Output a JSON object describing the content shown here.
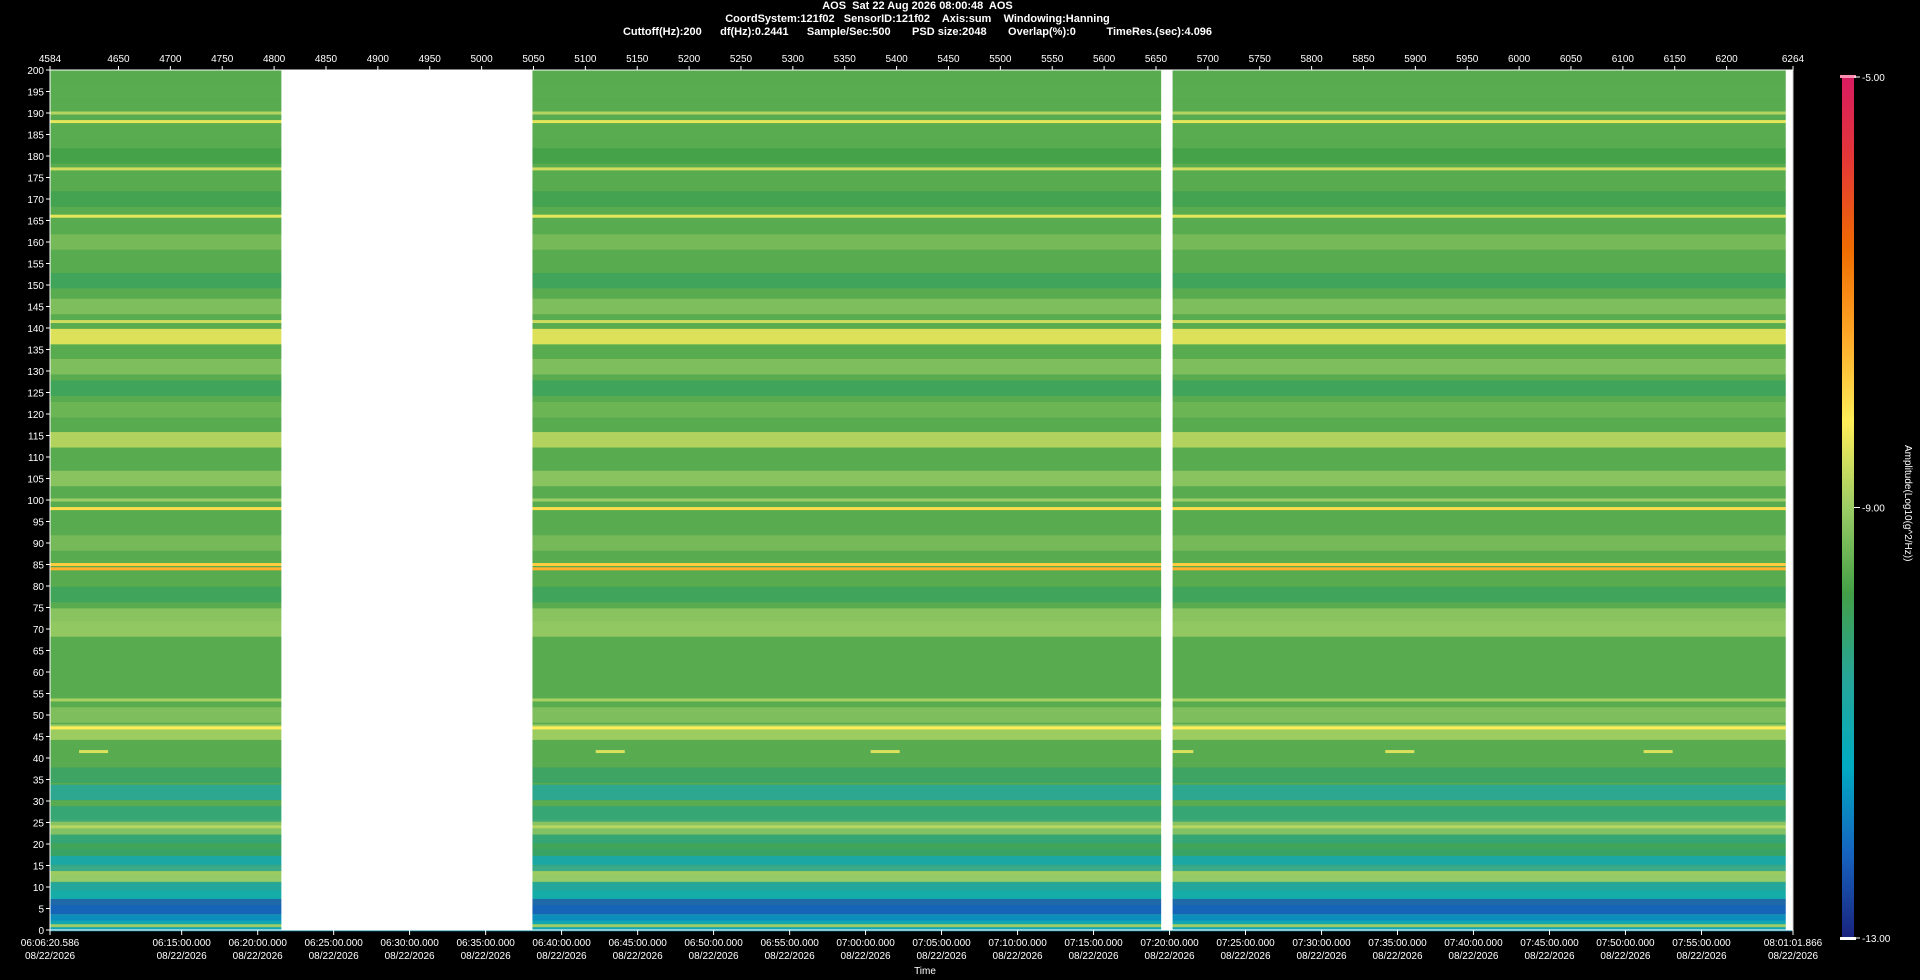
{
  "header": {
    "line1": "AOS  Sat 22 Aug 2026 08:00:48  AOS",
    "line2": "CoordSystem:121f02   SensorID:121f02    Axis:sum    Windowing:Hanning",
    "line3": "Cuttoff(Hz):200      df(Hz):0.2441      Sample/Sec:500       PSD size:2048       Overlap(%):0          TimeRes.(sec):4.096"
  },
  "chart_data": {
    "type": "heatmap",
    "title": "AOS  Sat 22 Aug 2026 08:00:48  AOS",
    "xlabel": "Time",
    "ylabel": "",
    "colorbar_label": "Amplitude(Log10(g^2/Hz))",
    "colorbar_range": [
      -13.0,
      -5.0
    ],
    "colorbar_ticks": [
      "-5.00",
      "-9.00",
      "-13.00"
    ],
    "colormap": [
      "#1a237e",
      "#1565c0",
      "#00acc1",
      "#26a69a",
      "#43a047",
      "#9ccc65",
      "#ffee58",
      "#ffa726",
      "#ef6c00",
      "#e53935",
      "#d81b60"
    ],
    "ylim": [
      0,
      200
    ],
    "y_ticks": [
      0,
      5,
      10,
      15,
      20,
      25,
      30,
      35,
      40,
      45,
      50,
      55,
      60,
      65,
      70,
      75,
      80,
      85,
      90,
      95,
      100,
      105,
      110,
      115,
      120,
      125,
      130,
      135,
      140,
      145,
      150,
      155,
      160,
      165,
      170,
      175,
      180,
      185,
      190,
      195,
      200
    ],
    "top_axis_range": [
      4584,
      6264
    ],
    "top_ticks": [
      4584,
      4650,
      4700,
      4750,
      4800,
      4850,
      4900,
      4950,
      5000,
      5050,
      5100,
      5150,
      5200,
      5250,
      5300,
      5350,
      5400,
      5450,
      5500,
      5550,
      5600,
      5650,
      5700,
      5750,
      5800,
      5850,
      5900,
      5950,
      6000,
      6050,
      6100,
      6150,
      6200,
      6264
    ],
    "time_ticks": [
      {
        "time": "06:06:20.586",
        "date": "08/22/2026",
        "top_value": 4584
      },
      {
        "time": "06:15:00.000",
        "date": "08/22/2026",
        "top_value": 4710.9
      },
      {
        "time": "06:20:00.000",
        "date": "08/22/2026",
        "top_value": 4784.2
      },
      {
        "time": "06:25:00.000",
        "date": "08/22/2026",
        "top_value": 4857.4
      },
      {
        "time": "06:30:00.000",
        "date": "08/22/2026",
        "top_value": 4930.6
      },
      {
        "time": "06:35:00.000",
        "date": "08/22/2026",
        "top_value": 5003.9
      },
      {
        "time": "06:40:00.000",
        "date": "08/22/2026",
        "top_value": 5077.1
      },
      {
        "time": "06:45:00.000",
        "date": "08/22/2026",
        "top_value": 5150.4
      },
      {
        "time": "06:50:00.000",
        "date": "08/22/2026",
        "top_value": 5223.6
      },
      {
        "time": "06:55:00.000",
        "date": "08/22/2026",
        "top_value": 5296.9
      },
      {
        "time": "07:00:00.000",
        "date": "08/22/2026",
        "top_value": 5370.1
      },
      {
        "time": "07:05:00.000",
        "date": "08/22/2026",
        "top_value": 5443.3
      },
      {
        "time": "07:10:00.000",
        "date": "08/22/2026",
        "top_value": 5516.6
      },
      {
        "time": "07:15:00.000",
        "date": "08/22/2026",
        "top_value": 5589.8
      },
      {
        "time": "07:20:00.000",
        "date": "08/22/2026",
        "top_value": 5663.1
      },
      {
        "time": "07:25:00.000",
        "date": "08/22/2026",
        "top_value": 5736.3
      },
      {
        "time": "07:30:00.000",
        "date": "08/22/2026",
        "top_value": 5809.6
      },
      {
        "time": "07:35:00.000",
        "date": "08/22/2026",
        "top_value": 5882.8
      },
      {
        "time": "07:40:00.000",
        "date": "08/22/2026",
        "top_value": 5956.0
      },
      {
        "time": "07:45:00.000",
        "date": "08/22/2026",
        "top_value": 6029.3
      },
      {
        "time": "07:50:00.000",
        "date": "08/22/2026",
        "top_value": 6102.5
      },
      {
        "time": "07:55:00.000",
        "date": "08/22/2026",
        "top_value": 6175.8
      },
      {
        "time": "08:01:01.866",
        "date": "08/22/2026",
        "top_value": 6264
      }
    ],
    "data_gaps": [
      [
        4807,
        5049
      ],
      [
        5655,
        5666
      ],
      [
        6257,
        6264
      ]
    ],
    "background_level": -9.6,
    "bands": [
      {
        "freq": 1.5,
        "level": -11.5
      },
      {
        "freq": 4,
        "level": -11.8
      },
      {
        "freq": 5.5,
        "level": -12.3
      },
      {
        "freq": 9,
        "level": -11.2
      },
      {
        "freq": 11,
        "level": -10.6
      },
      {
        "freq": 13,
        "level": -8.9
      },
      {
        "freq": 15.5,
        "level": -10.5
      },
      {
        "freq": 17,
        "level": -10.9
      },
      {
        "freq": 19,
        "level": -10.0
      },
      {
        "freq": 22,
        "level": -10.3
      },
      {
        "freq": 24,
        "level": -9.1
      },
      {
        "freq": 27,
        "level": -10.3
      },
      {
        "freq": 32,
        "level": -10.6
      },
      {
        "freq": 36,
        "level": -10.1
      },
      {
        "freq": 46,
        "level": -8.9
      },
      {
        "freq": 50,
        "level": -9.2
      },
      {
        "freq": 70,
        "level": -9.0
      },
      {
        "freq": 73,
        "level": -9.1
      },
      {
        "freq": 78,
        "level": -10.0
      },
      {
        "freq": 90,
        "level": -9.3
      },
      {
        "freq": 105,
        "level": -9.1
      },
      {
        "freq": 114,
        "level": -8.7
      },
      {
        "freq": 121,
        "level": -9.4
      },
      {
        "freq": 126,
        "level": -10.0
      },
      {
        "freq": 131,
        "level": -9.2
      },
      {
        "freq": 138,
        "level": -8.3
      },
      {
        "freq": 145,
        "level": -9.2
      },
      {
        "freq": 151,
        "level": -10.0
      },
      {
        "freq": 160,
        "level": -9.3
      },
      {
        "freq": 170,
        "level": -9.9
      },
      {
        "freq": 180,
        "level": -9.8
      },
      {
        "freq": 186,
        "level": -9.6
      },
      {
        "freq": 195,
        "level": -9.6
      }
    ],
    "tones": [
      {
        "freq": 1,
        "level": -9.0
      },
      {
        "freq": 24,
        "level": -8.8
      },
      {
        "freq": 47,
        "level": -8.2
      },
      {
        "freq": 53.5,
        "level": -8.9
      },
      {
        "freq": 84,
        "level": -7.5
      },
      {
        "freq": 85,
        "level": -7.8
      },
      {
        "freq": 98,
        "level": -8.0
      },
      {
        "freq": 100,
        "level": -9.0
      },
      {
        "freq": 141.5,
        "level": -8.6
      },
      {
        "freq": 166,
        "level": -8.4
      },
      {
        "freq": 177,
        "level": -8.6
      },
      {
        "freq": 188,
        "level": -8.4
      },
      {
        "freq": 190,
        "level": -8.8
      }
    ],
    "events": [
      {
        "start": 4612,
        "end": 4640,
        "freq": 41.5,
        "level": -8.5
      },
      {
        "start": 5110,
        "end": 5138,
        "freq": 41.5,
        "level": -8.5
      },
      {
        "start": 5375,
        "end": 5403,
        "freq": 41.5,
        "level": -8.5
      },
      {
        "start": 5666,
        "end": 5686,
        "freq": 41.5,
        "level": -8.5
      },
      {
        "start": 5871,
        "end": 5899,
        "freq": 41.5,
        "level": -8.5
      },
      {
        "start": 6120,
        "end": 6148,
        "freq": 41.5,
        "level": -8.5
      }
    ]
  }
}
